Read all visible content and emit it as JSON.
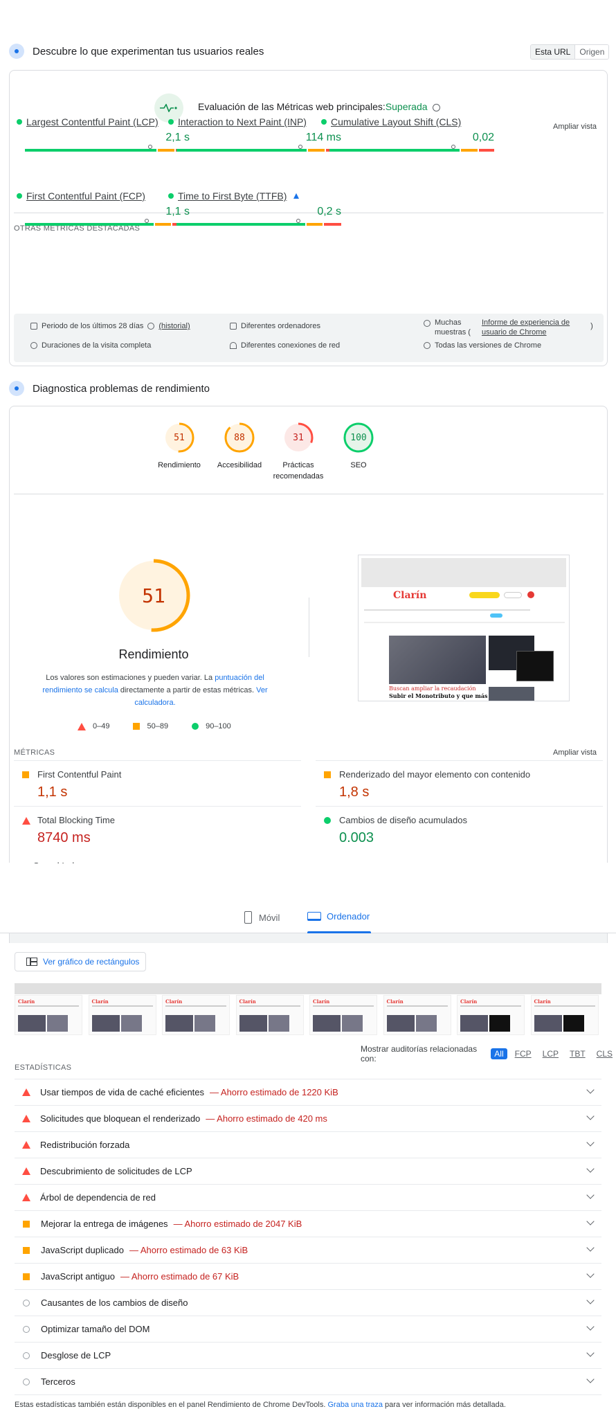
{
  "crux": {
    "title": "Descubre lo que experimentan tus usuarios reales",
    "toggle": [
      "Esta URL",
      "Origen"
    ],
    "assessment_label": "Evaluación de las Métricas web principales:",
    "assessment_status": "Superada",
    "expand": "Ampliar vista",
    "metrics": [
      {
        "name": "Largest Contentful Paint (LCP)",
        "value": "2,1 s",
        "marker": 0.76
      },
      {
        "name": "Interaction to Next Paint (INP)",
        "value": "114 ms",
        "marker": 0.75
      },
      {
        "name": "Cumulative Layout Shift (CLS)",
        "value": "0,02",
        "marker": 0.75
      }
    ],
    "other_label": "OTRAS MÉTRICAS DESTACADAS",
    "other_metrics": [
      {
        "name": "First Contentful Paint (FCP)",
        "value": "1,1 s",
        "marker": 0.74
      },
      {
        "name": "Time to First Byte (TTFB)",
        "value": "0,2 s",
        "marker": 0.74
      }
    ],
    "footer": {
      "period": "Periodo de los últimos 28 días",
      "history": "(historial)",
      "devices": "Diferentes ordenadores",
      "samples_a": "Muchas",
      "samples_b": "muestras (",
      "report_link_a": "Informe de experiencia de",
      "report_link_b": "usuario de Chrome",
      "paren": ")",
      "durations": "Duraciones de la visita completa",
      "connections": "Diferentes conexiones de red",
      "versions": "Todas las versiones de Chrome"
    }
  },
  "diag": {
    "title": "Diagnostica problemas de rendimiento",
    "scores": [
      {
        "value": "51",
        "label": "Rendimiento",
        "color": "#ffa400",
        "frac": 0.51
      },
      {
        "value": "88",
        "label": "Accesibilidad",
        "color": "#ffa400",
        "frac": 0.88
      },
      {
        "value": "31",
        "label": "Prácticas recomendadas",
        "color": "#ff4e42",
        "frac": 0.31
      },
      {
        "value": "100",
        "label": "SEO",
        "color": "#0cce6b",
        "frac": 1.0
      }
    ],
    "big_score": "51",
    "big_label": "Rendimiento",
    "desc_a": "Los valores son estimaciones y pueden variar. La ",
    "desc_link": "puntuación del rendimiento se calcula",
    "desc_b": " directamente a partir de estas métricas. ",
    "desc_link2": "Ver calculadora.",
    "legend": [
      "0–49",
      "50–89",
      "90–100"
    ],
    "metrics_label": "MÉTRICAS",
    "expand": "Ampliar vista",
    "lab_metrics": [
      {
        "name": "First Contentful Paint",
        "value": "1,1 s",
        "kind": "sq",
        "color": "#c33300"
      },
      {
        "name": "Renderizado del mayor elemento con contenido",
        "value": "1,8 s",
        "kind": "sq",
        "color": "#c33300"
      },
      {
        "name": "Total Blocking Time",
        "value": "8740 ms",
        "kind": "tri",
        "color": "#c5221f"
      },
      {
        "name": "Cambios de diseño acumulados",
        "value": "0.003",
        "kind": "ci",
        "color": "#0d904f"
      }
    ],
    "speed_partial": "Speed Index",
    "screenshot": {
      "logo": "Clarín",
      "headline_a": "Buscan ampliar la recaudación",
      "headline_b": "Subir el Monotributo y que más"
    }
  },
  "tabs": {
    "mobile": "Móvil",
    "desktop": "Ordenador"
  },
  "treemap_btn": "Ver gráfico de rectángulos",
  "thumb_logo": "Clarín",
  "filter": {
    "label": "Mostrar auditorías relacionadas con:",
    "chips": [
      "All",
      "FCP",
      "LCP",
      "TBT",
      "CLS"
    ]
  },
  "stats_label": "ESTADÍSTICAS",
  "audits": [
    {
      "kind": "tri",
      "text": "Usar tiempos de vida de caché eficientes",
      "saving": "— Ahorro estimado de 1220 KiB"
    },
    {
      "kind": "tri",
      "text": "Solicitudes que bloquean el renderizado",
      "saving": "— Ahorro estimado de 420 ms"
    },
    {
      "kind": "tri",
      "text": "Redistribución forzada",
      "saving": ""
    },
    {
      "kind": "tri",
      "text": "Descubrimiento de solicitudes de LCP",
      "saving": ""
    },
    {
      "kind": "tri",
      "text": "Árbol de dependencia de red",
      "saving": ""
    },
    {
      "kind": "sq",
      "text": "Mejorar la entrega de imágenes",
      "saving": "— Ahorro estimado de 2047 KiB"
    },
    {
      "kind": "sq",
      "text": "JavaScript duplicado",
      "saving": "— Ahorro estimado de 63 KiB"
    },
    {
      "kind": "sq",
      "text": "JavaScript antiguo",
      "saving": "— Ahorro estimado de 67 KiB"
    },
    {
      "kind": "emp",
      "text": "Causantes de los cambios de diseño",
      "saving": ""
    },
    {
      "kind": "emp",
      "text": "Optimizar tamaño del DOM",
      "saving": ""
    },
    {
      "kind": "emp",
      "text": "Desglose de LCP",
      "saving": ""
    },
    {
      "kind": "emp",
      "text": "Terceros",
      "saving": ""
    }
  ],
  "footnote_a": "Estas estadísticas también están disponibles en el panel Rendimiento de Chrome DevTools. ",
  "footnote_link": "Graba una traza",
  "footnote_b": " para ver información más detallada."
}
